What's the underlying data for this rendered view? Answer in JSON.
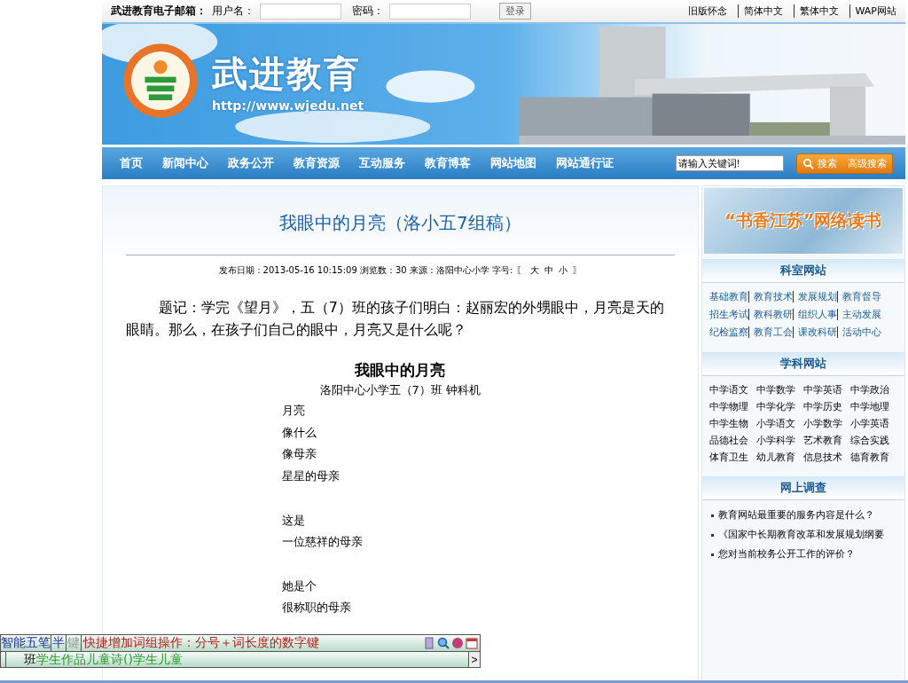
{
  "top_bar": {
    "email_label": "武进教育电子邮箱：",
    "username_label": "用户名：",
    "password_label": "密码：",
    "login_button": "登录",
    "links": [
      "旧版怀念",
      "简体中文",
      "繁体中文",
      "WAP网站"
    ]
  },
  "banner": {
    "title": "武进教育",
    "url": "http://www.wjedu.net"
  },
  "nav": {
    "items": [
      "首页",
      "新闻中心",
      "政务公开",
      "教育资源",
      "互动服务",
      "教育博客",
      "网站地图",
      "网站通行证"
    ],
    "search_value": "请输入关键词!",
    "search_button": "搜索",
    "advanced_button": "高级搜索"
  },
  "article": {
    "title": "我眼中的月亮（洛小五7组稿）",
    "meta": "发布日期：2013-05-16 10:15:09 浏览数：30 来源：洛阳中心小学 字号:",
    "size_open": "〖",
    "sizes": [
      "大",
      "中",
      "小"
    ],
    "size_close": "〗",
    "intro": "题记：学完《望月》，五（7）班的孩子们明白：赵丽宏的外甥眼中，月亮是天的眼睛。那么，在孩子们自己的眼中，月亮又是什么呢？",
    "poem_title": "我眼中的月亮",
    "poem_author": "洛阳中心小学五（7）班 钟科机",
    "stanzas": [
      [
        "月亮",
        "像什么",
        "像母亲",
        "星星的母亲"
      ],
      [
        "这是",
        "一位慈祥的母亲"
      ],
      [
        "她是个",
        "很称职的母亲"
      ]
    ]
  },
  "sidebar": {
    "banner_text": "“书香江苏”网络读书",
    "sections": [
      {
        "kind": "links",
        "title": "科室网站",
        "items": [
          "基础教育",
          "教育技术",
          "发展规划",
          "教育督导",
          "招生考试",
          "教科教研",
          "组织人事",
          "主动发展",
          "纪检监察",
          "教育工会",
          "课改科研",
          "活动中心"
        ]
      },
      {
        "kind": "grid",
        "title": "学科网站",
        "items": [
          "中学语文",
          "中学数学",
          "中学英语",
          "中学政治",
          "中学物理",
          "中学化学",
          "中学历史",
          "中学地理",
          "中学生物",
          "小学语文",
          "小学数学",
          "小学英语",
          "品德社会",
          "小学科学",
          "艺术教育",
          "综合实践",
          "体育卫生",
          "幼儿教育",
          "信息技术",
          "德育教育"
        ]
      },
      {
        "kind": "list",
        "title": "网上调查",
        "items": [
          "教育网站最重要的服务内容是什么？",
          "《国家中长期教育改革和发展规划纲要",
          "您对当前校务公开工作的评价？"
        ]
      }
    ]
  },
  "ime": {
    "mode": "智能五笔",
    "width": "半",
    "key": "键",
    "hint": "快捷增加词组操作：分号＋词长度的数字键",
    "typed": "班",
    "candidates": "学生作品儿童诗()学生儿童",
    "next": ">"
  }
}
